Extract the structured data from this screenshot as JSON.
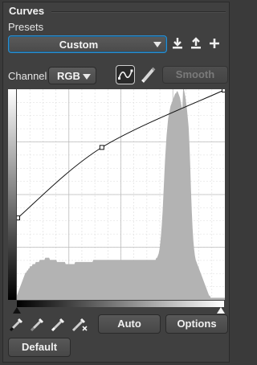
{
  "section": {
    "title": "Curves"
  },
  "presets": {
    "label": "Presets",
    "selected": "Custom"
  },
  "preset_icons": [
    "download-icon",
    "upload-icon",
    "plus-icon"
  ],
  "channel": {
    "label": "Channel",
    "selected": "RGB"
  },
  "tools": {
    "curve": "curve-tool-icon",
    "pencil": "pencil-tool-icon"
  },
  "buttons": {
    "smooth": "Smooth",
    "auto": "Auto",
    "options": "Options",
    "default": "Default"
  },
  "eyedroppers": [
    "black-point-eyedropper-icon",
    "gray-point-eyedropper-icon",
    "white-point-eyedropper-icon",
    "remove-eyedropper-icon"
  ],
  "accent": "#2b8fd1",
  "curve": {
    "points": [
      [
        0,
        99
      ],
      [
        104,
        185
      ],
      [
        255,
        255
      ]
    ]
  },
  "histogram": [
    2,
    3,
    4,
    5,
    6,
    7,
    8,
    9,
    10,
    11,
    12,
    13,
    13,
    14,
    14,
    15,
    15,
    16,
    16,
    16,
    17,
    17,
    17,
    17,
    18,
    18,
    18,
    18,
    18,
    19,
    19,
    19,
    19,
    19,
    19,
    19,
    20,
    20,
    20,
    20,
    20,
    20,
    19,
    19,
    19,
    19,
    19,
    19,
    19,
    19,
    19,
    18,
    18,
    18,
    18,
    18,
    18,
    18,
    18,
    18,
    18,
    18,
    17,
    17,
    17,
    17,
    17,
    17,
    17,
    17,
    17,
    17,
    17,
    17,
    18,
    18,
    18,
    18,
    18,
    18,
    18,
    18,
    18,
    18,
    18,
    18,
    18,
    18,
    18,
    18,
    18,
    18,
    18,
    18,
    18,
    18,
    18,
    19,
    19,
    19,
    19,
    19,
    19,
    19,
    19,
    19,
    19,
    19,
    19,
    19,
    19,
    19,
    19,
    19,
    19,
    19,
    19,
    19,
    19,
    19,
    19,
    19,
    19,
    19,
    19,
    19,
    19,
    19,
    19,
    19,
    19,
    19,
    19,
    19,
    19,
    19,
    19,
    19,
    19,
    19,
    19,
    19,
    19,
    19,
    19,
    19,
    19,
    19,
    19,
    19,
    19,
    19,
    19,
    19,
    19,
    19,
    19,
    19,
    19,
    19,
    19,
    19,
    19,
    19,
    19,
    19,
    19,
    19,
    19,
    19,
    19,
    19,
    19,
    19,
    19,
    19,
    19,
    20,
    20,
    21,
    22,
    24,
    27,
    31,
    36,
    42,
    50,
    58,
    66,
    72,
    78,
    82,
    86,
    88,
    90,
    92,
    93,
    94,
    95,
    96,
    97,
    98,
    98,
    99,
    99,
    98,
    97,
    96,
    94,
    92,
    90,
    100,
    100,
    98,
    96,
    93,
    90,
    86,
    82,
    74,
    64,
    52,
    42,
    34,
    28,
    24,
    21,
    19,
    18,
    17,
    16,
    15,
    14,
    13,
    12,
    11,
    10,
    9,
    8,
    7,
    6,
    5,
    4,
    3,
    2,
    2,
    1,
    1,
    1,
    1,
    1,
    1,
    1,
    1,
    1,
    1,
    1,
    1,
    1,
    1,
    1,
    1,
    1,
    1,
    1
  ]
}
